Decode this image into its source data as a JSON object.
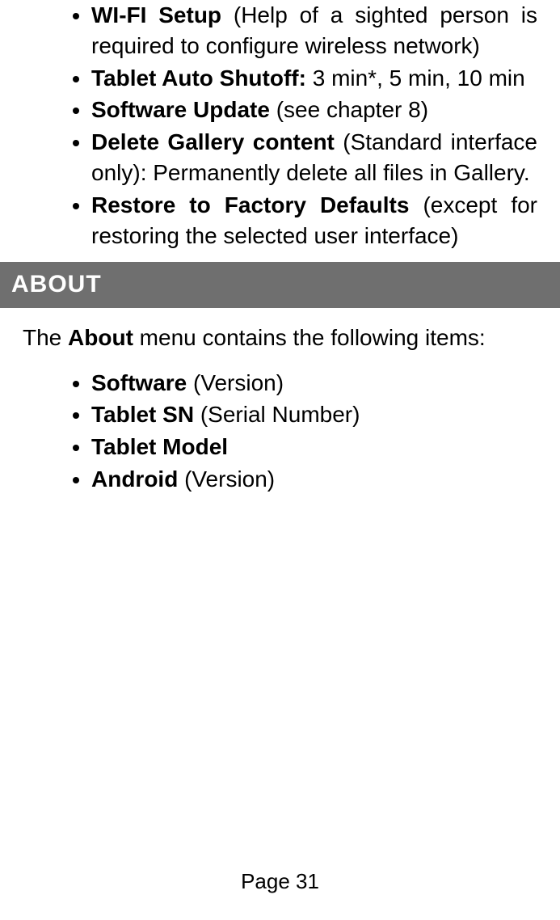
{
  "list1": [
    {
      "bold": "WI-FI Setup",
      "rest": " (Help of a sighted person is required to configure wireless network)"
    },
    {
      "bold": "Tablet Auto Shutoff:",
      "rest": " 3 min*, 5 min, 10 min"
    },
    {
      "bold": "Software Update",
      "rest": " (see chapter 8)"
    },
    {
      "bold": "Delete Gallery content",
      "rest": " (Standard interface only): Permanently delete all files in Gallery."
    },
    {
      "bold": "Restore to Factory Defaults",
      "rest": " (except for restoring the selected user interface)"
    }
  ],
  "section_header": "ABOUT",
  "intro_pre": "The ",
  "intro_bold": "About",
  "intro_post": " menu contains the following items:",
  "list2": [
    {
      "bold": "Software",
      "rest": " (Version)"
    },
    {
      "bold": "Tablet SN",
      "rest": " (Serial Number)"
    },
    {
      "bold": "Tablet Model",
      "rest": ""
    },
    {
      "bold": "Android",
      "rest": " (Version)"
    }
  ],
  "page_number": "Page 31"
}
